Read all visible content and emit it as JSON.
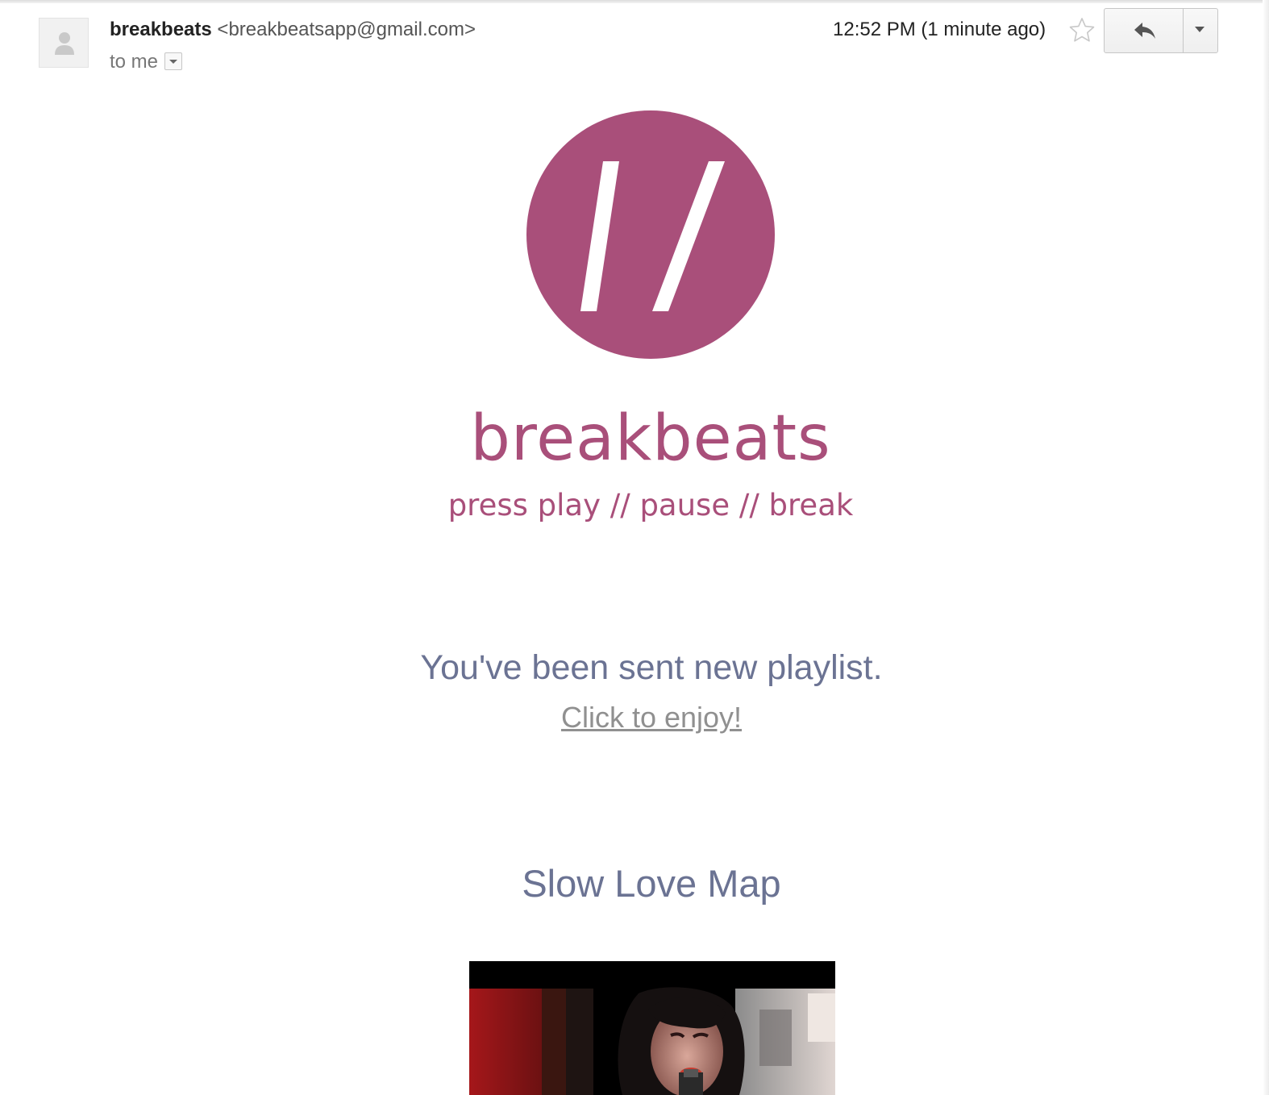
{
  "email": {
    "sender_name": "breakbeats",
    "sender_email": "<breakbeatsapp@gmail.com>",
    "to": "to me",
    "timestamp": "12:52 PM (1 minute ago)"
  },
  "icons": {
    "avatar": "person-icon",
    "star": "star-outline-icon",
    "reply": "reply-arrow-icon",
    "more": "chevron-down-icon",
    "logo": "double-slash-logo"
  },
  "body": {
    "brand_name": "breakbeats",
    "tagline": "press play // pause // break",
    "headline": "You've been sent new playlist.",
    "cta": "Click to enjoy!",
    "playlist_title": "Slow Love Map"
  },
  "colors": {
    "brand": "#a94f7a",
    "headline": "#6b7393",
    "link": "#909090"
  }
}
